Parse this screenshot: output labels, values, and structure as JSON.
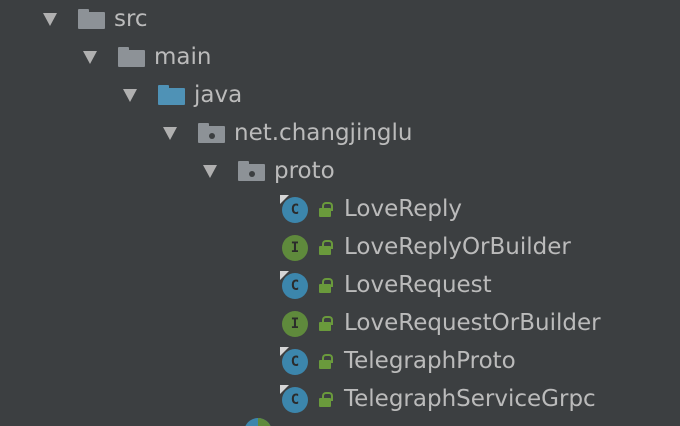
{
  "project_tree": {
    "src": {
      "label": "src",
      "icon": "folder-icon",
      "expanded": true
    },
    "main": {
      "label": "main",
      "icon": "folder-icon",
      "expanded": true
    },
    "java": {
      "label": "java",
      "icon": "source-root-folder-icon",
      "expanded": true
    },
    "package_net": {
      "label": "net.changjinglu",
      "icon": "package-icon",
      "expanded": true
    },
    "package_proto": {
      "label": "proto",
      "icon": "package-icon",
      "expanded": true
    },
    "files": [
      {
        "label": "LoveReply",
        "kind": "C",
        "icon": "class-icon"
      },
      {
        "label": "LoveReplyOrBuilder",
        "kind": "I",
        "icon": "interface-icon"
      },
      {
        "label": "LoveRequest",
        "kind": "C",
        "icon": "class-icon"
      },
      {
        "label": "LoveRequestOrBuilder",
        "kind": "I",
        "icon": "interface-icon"
      },
      {
        "label": "TelegraphProto",
        "kind": "C",
        "icon": "class-icon"
      },
      {
        "label": "TelegraphServiceGrpc",
        "kind": "C",
        "icon": "class-icon"
      }
    ]
  },
  "colors": {
    "background": "#3c3f41",
    "text": "#bbbbbb",
    "folder_grey": "#8d9297",
    "source_root_blue": "#4f92b6",
    "class_icon": "#3c86ac",
    "interface_icon": "#5f8a3c",
    "lock_green": "#6a9a3c"
  }
}
